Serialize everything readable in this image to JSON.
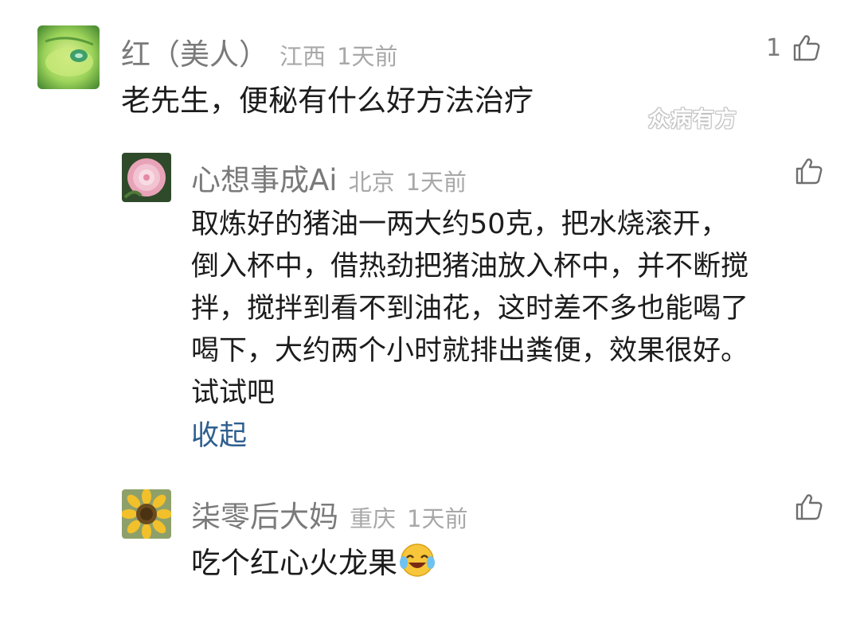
{
  "watermark": "众病有方",
  "comments": [
    {
      "name": "红（美人）",
      "location": "江西",
      "time": "1天前",
      "like_count": "1",
      "text": "老先生，便秘有什么好方法治疗",
      "avatar_icon": "green-beetle-on-leaf-avatar"
    },
    {
      "name": "心想事成Ai",
      "location": "北京",
      "time": "1天前",
      "like_count": "",
      "lines": [
        "取炼好的猪油一两大约50克，把水烧滚开，",
        "倒入杯中，借热劲把猪油放入杯中，并不断搅",
        "拌，搅拌到看不到油花，这时差不多也能喝了",
        "喝下，大约两个小时就排出粪便，效果很好。",
        "试试吧"
      ],
      "collapse_label": "收起",
      "avatar_icon": "pink-peony-avatar"
    },
    {
      "name": "柒零后大妈",
      "location": "重庆",
      "time": "1天前",
      "like_count": "",
      "text": "吃个红心火龙果",
      "emoji_icon": "laughing-crying-emoji",
      "avatar_icon": "sunflower-avatar"
    }
  ]
}
